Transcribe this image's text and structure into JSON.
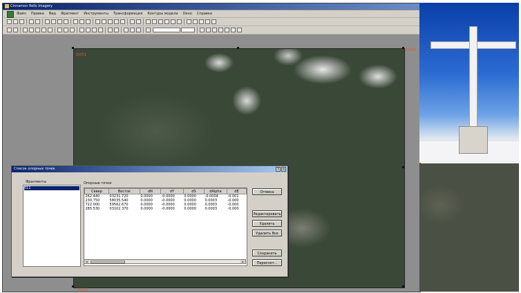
{
  "window": {
    "title": "Cinnamon Rolls Imagery",
    "menu": [
      "Файл",
      "Правка",
      "Вид",
      "Фрагмент",
      "Инструменты",
      "Трансформация",
      "Контуры модели",
      "Окно",
      "Справка"
    ]
  },
  "photo_labels": {
    "top_left": "0001",
    "top_right": "0004",
    "bottom_left": "0002"
  },
  "dialog": {
    "title": "Список опорных точек",
    "help_btn": "?",
    "close_btn": "×",
    "fragments_label": "Фрагменты",
    "fragments": [
      "011"
    ],
    "points_label": "Опорные точки",
    "columns": [
      "Север",
      "Восток",
      "dN",
      "dY",
      "dS",
      "dAlpha",
      "dE"
    ],
    "rows": [
      [
        "262.440",
        "03231.720",
        "0.0000",
        "-0.0000",
        "0.0000",
        "-0.0004",
        "-0.001"
      ],
      [
        "230.750",
        "58035.540",
        "0.0000",
        "-0.0000",
        "0.0000",
        "0.0003",
        "-0.000"
      ],
      [
        "722.000",
        "59562.670",
        "0.0000",
        "-0.0000",
        "0.0000",
        "0.0003",
        "-0.000"
      ],
      [
        "285.530",
        "03102.370",
        "0.0000",
        "-0.0000",
        "0.0000",
        "0.0003",
        "-0.000"
      ]
    ],
    "buttons": {
      "cancel": "Отмена",
      "edit": "Редактировать",
      "delete": "Удалить",
      "delete_all": "Удалить Все",
      "save": "Сохранить",
      "calc": "Пересчет..."
    }
  }
}
